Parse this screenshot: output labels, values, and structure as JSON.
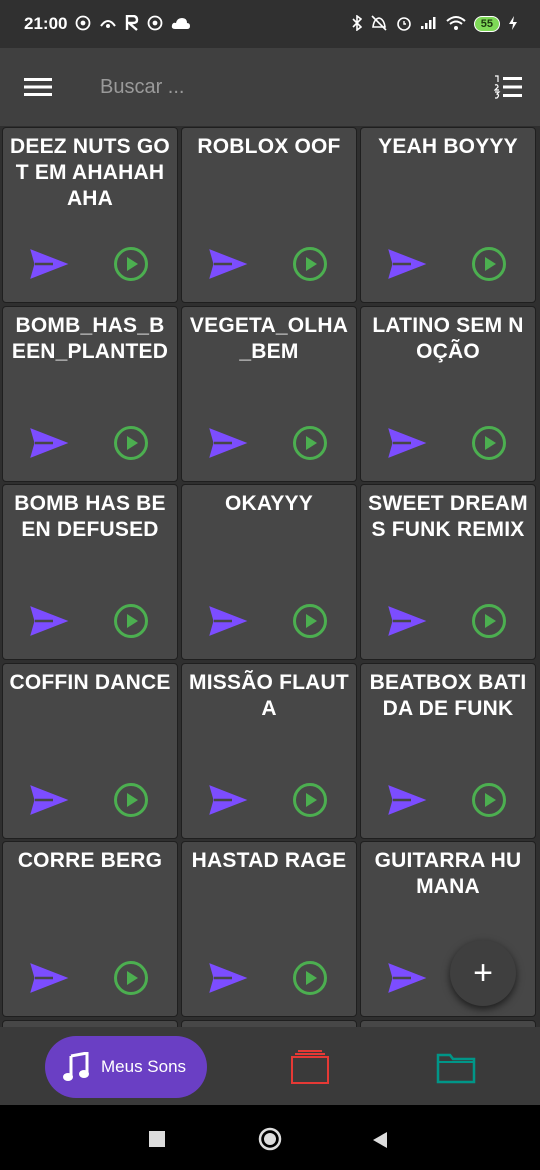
{
  "status_bar": {
    "time": "21:00",
    "battery": "55",
    "left_icons": [
      "whatsapp-icon",
      "hotspot-icon",
      "r-app-icon",
      "whatsapp-icon",
      "cloud-icon"
    ],
    "right_icons": [
      "bluetooth-icon",
      "mute-icon",
      "alarm-icon",
      "signal-icon",
      "wifi-icon",
      "battery-icon",
      "charging-icon"
    ]
  },
  "toolbar": {
    "menu_icon": "hamburger-menu-icon",
    "search_placeholder": "Buscar ...",
    "sort_icon": "sort-list-icon"
  },
  "sounds": [
    {
      "title": "DEEZ NUTS GOT EM AHAHAHAHA"
    },
    {
      "title": "ROBLOX OOF"
    },
    {
      "title": "YEAH BOYYY"
    },
    {
      "title": "BOMB_HAS_BEEN_PLANTED"
    },
    {
      "title": "VEGETA_OLHA_BEM"
    },
    {
      "title": "LATINO SEM NOÇÃO"
    },
    {
      "title": "BOMB HAS BEEN DEFUSED"
    },
    {
      "title": "OKAYYY"
    },
    {
      "title": "SWEET DREAMS FUNK REMIX"
    },
    {
      "title": "COFFIN DANCE"
    },
    {
      "title": "MISSÃO FLAUTA"
    },
    {
      "title": "BEATBOX BATIDA DE FUNK"
    },
    {
      "title": "CORRE BERG"
    },
    {
      "title": "HASTAD RAGE"
    },
    {
      "title": "GUITARRA HUMANA"
    },
    {
      "title": ""
    },
    {
      "title": ""
    },
    {
      "title": ""
    }
  ],
  "card_icons": {
    "send": "send-icon",
    "play": "play-circle-icon"
  },
  "fab": {
    "label": "+",
    "icon": "add-icon"
  },
  "bottom_nav": {
    "meus_sons_label": "Meus Sons",
    "meus_sons_icon": "music-note-icon",
    "cart_icon": "cart-icon",
    "folder_icon": "folder-icon"
  },
  "colors": {
    "accent_purple": "#7c4dff",
    "play_green": "#4caf50",
    "nav_active": "#6a3fc4",
    "cart_red": "#e53935",
    "folder_teal": "#009688"
  }
}
